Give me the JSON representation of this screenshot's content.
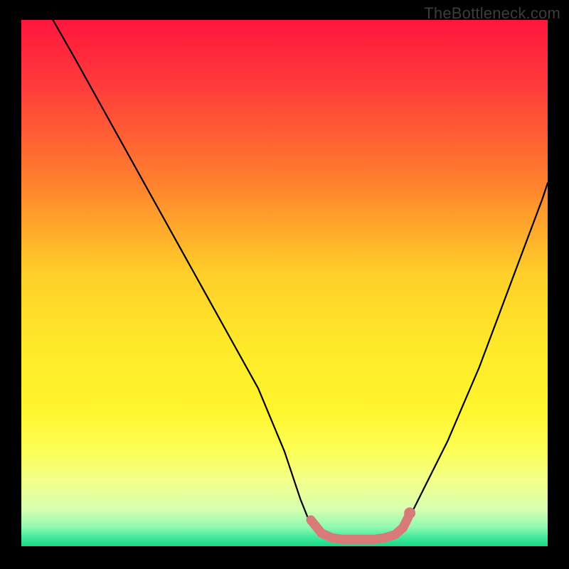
{
  "attribution": "TheBottleneck.com",
  "chart_data": {
    "type": "line",
    "title": "",
    "xlabel": "",
    "ylabel": "",
    "xlim": [
      0,
      100
    ],
    "ylim": [
      0,
      100
    ],
    "series": [
      {
        "name": "left-curve",
        "x": [
          6,
          10,
          15,
          20,
          25,
          30,
          35,
          40,
          45,
          50,
          53,
          55,
          57
        ],
        "y": [
          100,
          93,
          84,
          75,
          66,
          57,
          48,
          39,
          30,
          18,
          9,
          4,
          2
        ]
      },
      {
        "name": "valley-band",
        "x": [
          55,
          57,
          59,
          61,
          63,
          65,
          67,
          69,
          71,
          72,
          73,
          74
        ],
        "y": [
          4,
          2,
          1.2,
          1,
          1,
          1,
          1,
          1.2,
          1.8,
          2.6,
          4,
          6
        ]
      },
      {
        "name": "right-curve",
        "x": [
          73,
          75,
          78,
          81,
          84,
          87,
          90,
          93,
          96,
          99,
          100
        ],
        "y": [
          4,
          8,
          14,
          20,
          27,
          34,
          42,
          50,
          58,
          66,
          69
        ]
      }
    ],
    "highlight": {
      "name": "min-region",
      "color": "#d87b78",
      "stroke_width": 13,
      "x": [
        55,
        57,
        59,
        61,
        63,
        65,
        67,
        69,
        71,
        72.5,
        73.5
      ],
      "y": [
        5,
        2.5,
        1.6,
        1.3,
        1.3,
        1.3,
        1.3,
        1.6,
        2.2,
        3.5,
        5.5
      ]
    },
    "highlight_endpoint": {
      "x": 73.8,
      "y": 6.3,
      "r": 8,
      "color": "#d87b78"
    },
    "gradient_stops": [
      {
        "offset": 0.0,
        "color": "#ff163e"
      },
      {
        "offset": 0.12,
        "color": "#ff3a3a"
      },
      {
        "offset": 0.3,
        "color": "#ff7d2f"
      },
      {
        "offset": 0.48,
        "color": "#ffce2a"
      },
      {
        "offset": 0.62,
        "color": "#ffe92a"
      },
      {
        "offset": 0.74,
        "color": "#fff52e"
      },
      {
        "offset": 0.82,
        "color": "#fcff57"
      },
      {
        "offset": 0.88,
        "color": "#f1ff8e"
      },
      {
        "offset": 0.93,
        "color": "#d7ffb0"
      },
      {
        "offset": 0.965,
        "color": "#8cf9b0"
      },
      {
        "offset": 0.985,
        "color": "#3de89a"
      },
      {
        "offset": 1.0,
        "color": "#17d884"
      }
    ]
  }
}
